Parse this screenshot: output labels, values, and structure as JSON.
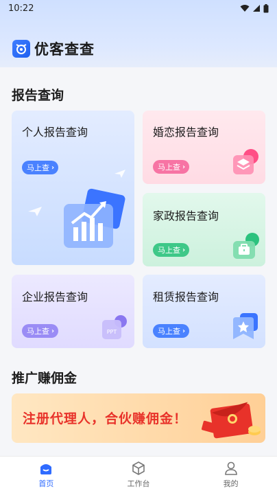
{
  "status_bar": {
    "time": "10:22"
  },
  "app": {
    "title": "优客查查"
  },
  "sections": {
    "report": "报告查询",
    "promote": "推广赚佣金"
  },
  "cards": {
    "personal": {
      "title": "个人报告查询",
      "action": "马上查"
    },
    "marriage": {
      "title": "婚恋报告查询",
      "action": "马上查"
    },
    "house": {
      "title": "家政报告查询",
      "action": "马上查"
    },
    "company": {
      "title": "企业报告查询",
      "action": "马上查",
      "badge": "PPT"
    },
    "rent": {
      "title": "租赁报告查询",
      "action": "马上查"
    }
  },
  "banner": {
    "text": "注册代理人，合伙赚佣金！"
  },
  "tabs": [
    {
      "label": "首页",
      "icon": "home-icon",
      "active": true
    },
    {
      "label": "工作台",
      "icon": "cube-icon",
      "active": false
    },
    {
      "label": "我的",
      "icon": "user-icon",
      "active": false
    }
  ],
  "colors": {
    "accent": "#2f6bff",
    "pill_blue": "#4a82ff",
    "pill_pink": "#f774a4",
    "pill_green": "#3ec888",
    "pill_purple": "#9a8cf5",
    "banner_text": "#e8322a"
  }
}
